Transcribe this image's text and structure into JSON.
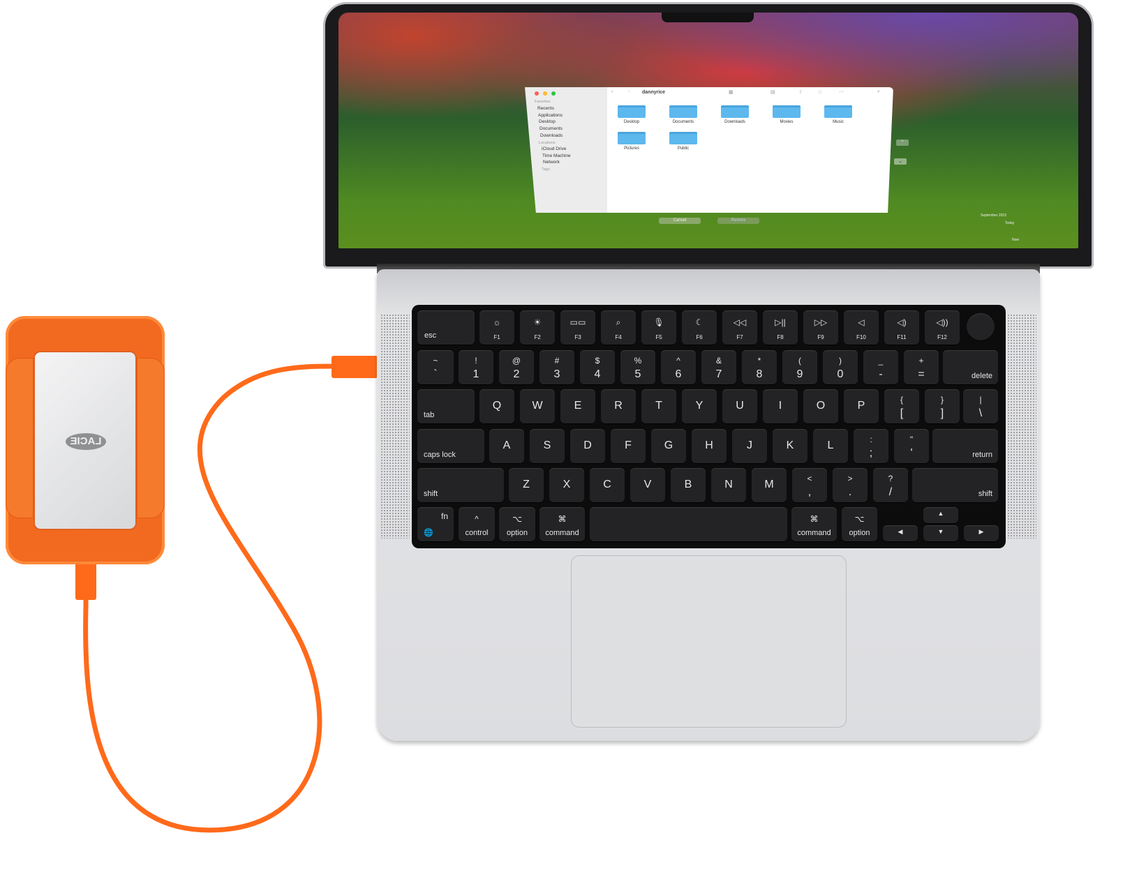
{
  "drive": {
    "brand": "LACIE",
    "color": "#f26a1f"
  },
  "cable_color": "#ff6a1a",
  "screen": {
    "finder": {
      "title": "dannyrice",
      "sidebar": {
        "favorites_header": "Favorites",
        "favorites": [
          "Recents",
          "Applications",
          "Desktop",
          "Documents",
          "Downloads"
        ],
        "locations_header": "Locations",
        "locations": [
          "iCloud Drive",
          "Time Machine",
          "Network"
        ],
        "tags_header": "Tags"
      },
      "folders": [
        "Desktop",
        "Documents",
        "Downloads",
        "Movies",
        "Music",
        "Pictures",
        "Public"
      ]
    },
    "buttons": {
      "cancel": "Cancel",
      "restore": "Restore"
    },
    "timeline": {
      "month": "September 2023",
      "today": "Today",
      "now": "Now"
    }
  },
  "keyboard": {
    "rows": [
      [
        {
          "m": "esc"
        },
        {
          "t": "☼",
          "s": "F1"
        },
        {
          "t": "☀",
          "s": "F2"
        },
        {
          "t": "▭▭",
          "s": "F3"
        },
        {
          "t": "⌕",
          "s": "F4"
        },
        {
          "t": "🎙",
          "s": "F5"
        },
        {
          "t": "☾",
          "s": "F6"
        },
        {
          "t": "◁◁",
          "s": "F7"
        },
        {
          "t": "▷||",
          "s": "F8"
        },
        {
          "t": "▷▷",
          "s": "F9"
        },
        {
          "t": "◁",
          "s": "F10"
        },
        {
          "t": "◁)",
          "s": "F11"
        },
        {
          "t": "◁))",
          "s": "F12"
        },
        {
          "m": ""
        }
      ],
      [
        {
          "t": "~",
          "m": "`"
        },
        {
          "t": "!",
          "m": "1"
        },
        {
          "t": "@",
          "m": "2"
        },
        {
          "t": "#",
          "m": "3"
        },
        {
          "t": "$",
          "m": "4"
        },
        {
          "t": "%",
          "m": "5"
        },
        {
          "t": "^",
          "m": "6"
        },
        {
          "t": "&",
          "m": "7"
        },
        {
          "t": "*",
          "m": "8"
        },
        {
          "t": "(",
          "m": "9"
        },
        {
          "t": ")",
          "m": "0"
        },
        {
          "t": "_",
          "m": "-"
        },
        {
          "t": "+",
          "m": "="
        },
        {
          "s": "delete"
        }
      ],
      [
        {
          "s": "tab"
        },
        {
          "m": "Q"
        },
        {
          "m": "W"
        },
        {
          "m": "E"
        },
        {
          "m": "R"
        },
        {
          "m": "T"
        },
        {
          "m": "Y"
        },
        {
          "m": "U"
        },
        {
          "m": "I"
        },
        {
          "m": "O"
        },
        {
          "m": "P"
        },
        {
          "t": "{",
          "m": "["
        },
        {
          "t": "}",
          "m": "]"
        },
        {
          "t": "|",
          "m": "\\"
        }
      ],
      [
        {
          "s": "caps lock"
        },
        {
          "m": "A"
        },
        {
          "m": "S"
        },
        {
          "m": "D"
        },
        {
          "m": "F"
        },
        {
          "m": "G"
        },
        {
          "m": "H"
        },
        {
          "m": "J"
        },
        {
          "m": "K"
        },
        {
          "m": "L"
        },
        {
          "t": ":",
          "m": ";"
        },
        {
          "t": "\"",
          "m": "'"
        },
        {
          "s": "return"
        }
      ],
      [
        {
          "s": "shift"
        },
        {
          "m": "Z"
        },
        {
          "m": "X"
        },
        {
          "m": "C"
        },
        {
          "m": "V"
        },
        {
          "m": "B"
        },
        {
          "m": "N"
        },
        {
          "m": "M"
        },
        {
          "t": "<",
          "m": ","
        },
        {
          "t": ">",
          "m": "."
        },
        {
          "t": "?",
          "m": "/"
        },
        {
          "s": "shift"
        }
      ],
      [
        {
          "t": "fn",
          "s": "🌐"
        },
        {
          "t": "^",
          "s": "control"
        },
        {
          "t": "⌥",
          "s": "option"
        },
        {
          "t": "⌘",
          "s": "command"
        },
        {
          "m": ""
        },
        {
          "t": "⌘",
          "s": "command"
        },
        {
          "t": "⌥",
          "s": "option"
        },
        {
          "m": "◀"
        },
        {
          "m": "▲"
        },
        {
          "m": "▼"
        },
        {
          "m": "▶"
        }
      ]
    ]
  }
}
